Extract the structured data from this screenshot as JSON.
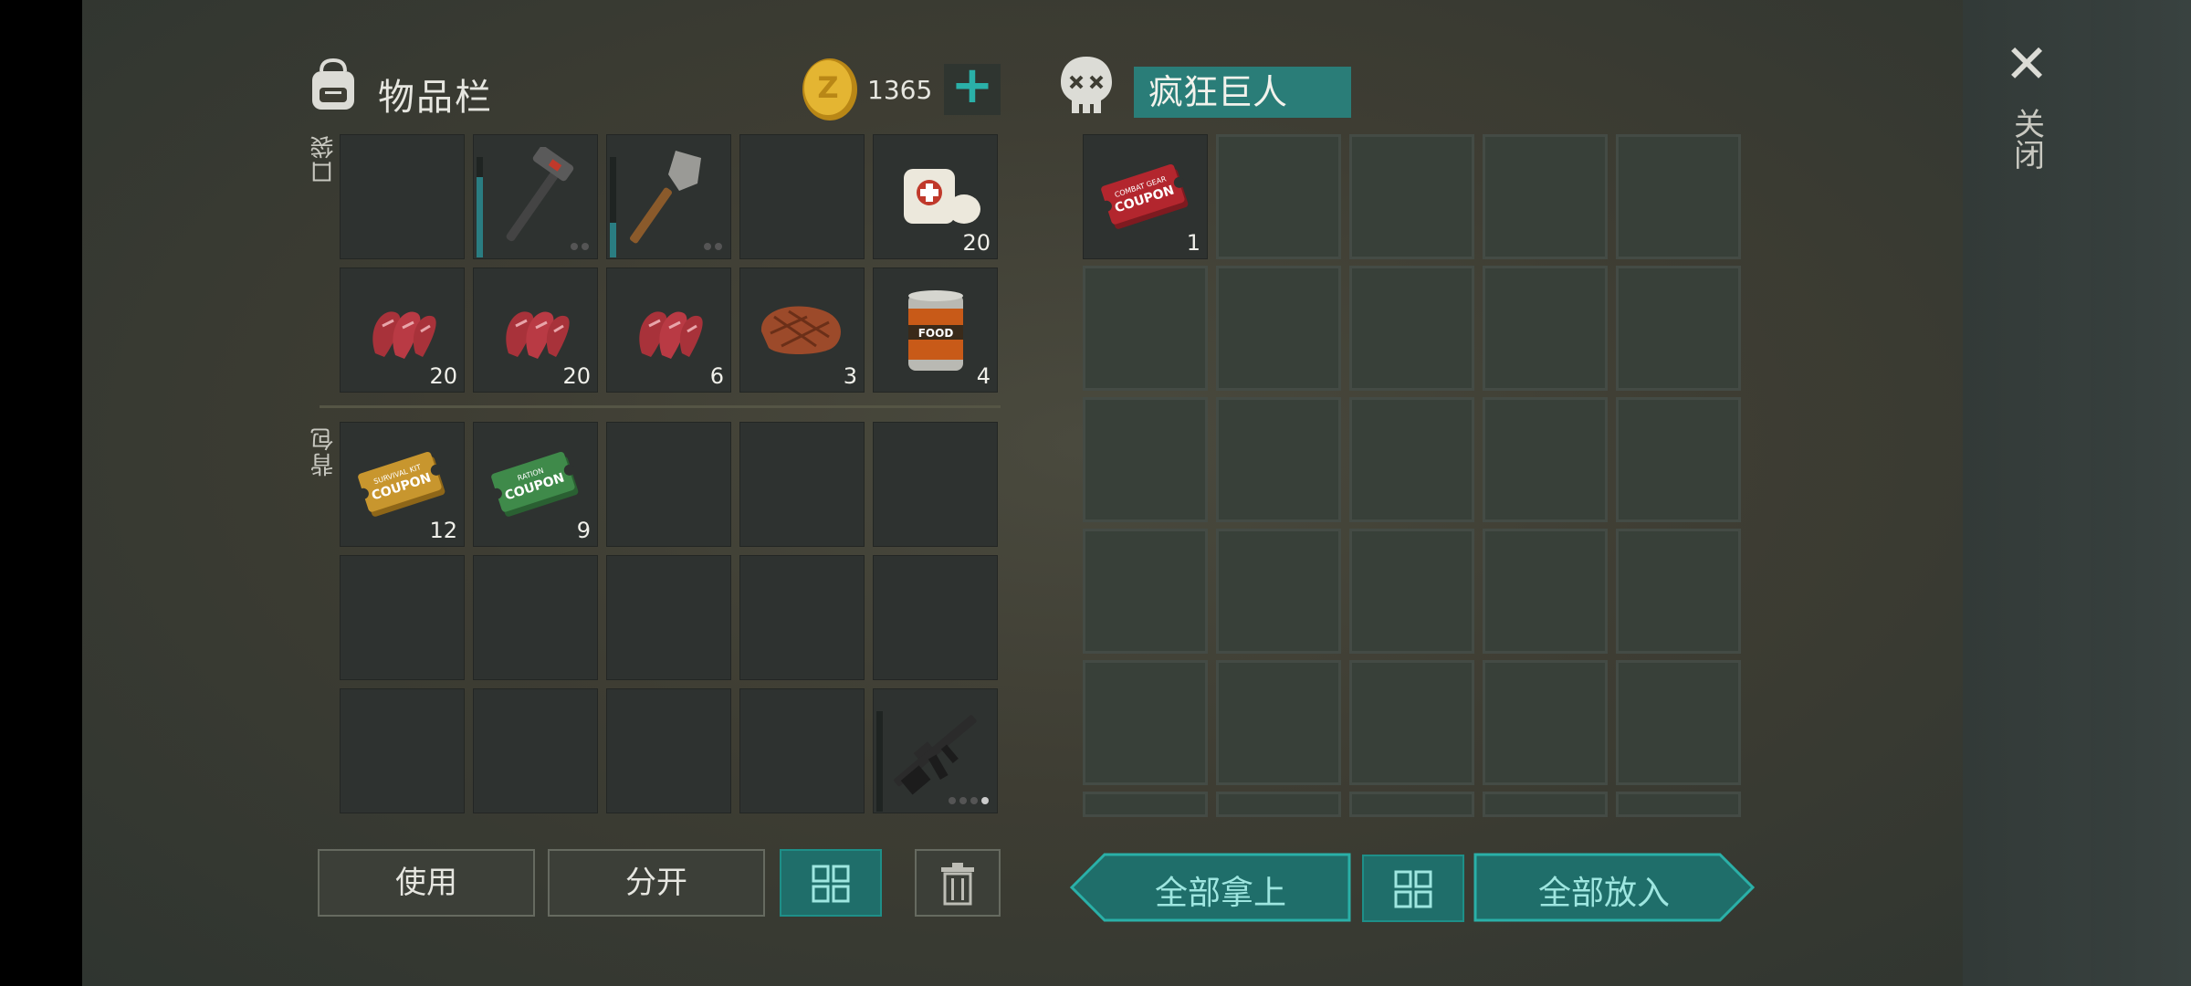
{
  "inventory": {
    "title": "物品栏",
    "pocket_label": "口袋",
    "backpack_label": "背包",
    "coins": "1365",
    "add_symbol": "+",
    "pocket_slots": [
      {
        "item": "",
        "count": ""
      },
      {
        "item": "hammer",
        "count": "",
        "durability": 0.8
      },
      {
        "item": "shovel",
        "count": "",
        "durability": 0.35
      },
      {
        "item": "",
        "count": ""
      },
      {
        "item": "bandage",
        "count": "20"
      },
      {
        "item": "raw-meat",
        "count": "20"
      },
      {
        "item": "raw-meat",
        "count": "20"
      },
      {
        "item": "raw-meat",
        "count": "6"
      },
      {
        "item": "steak",
        "count": "3"
      },
      {
        "item": "canned-food",
        "count": "4"
      }
    ],
    "backpack_slots": [
      {
        "item": "survival-kit-coupon",
        "count": "12",
        "ticket_top": "SURVIVAL KIT",
        "ticket_main": "COUPON"
      },
      {
        "item": "ration-coupon",
        "count": "9",
        "ticket_top": "RATION",
        "ticket_main": "COUPON"
      },
      {
        "item": "",
        "count": ""
      },
      {
        "item": "",
        "count": ""
      },
      {
        "item": "",
        "count": ""
      },
      {
        "item": "",
        "count": ""
      },
      {
        "item": "",
        "count": ""
      },
      {
        "item": "",
        "count": ""
      },
      {
        "item": "",
        "count": ""
      },
      {
        "item": "",
        "count": ""
      },
      {
        "item": "",
        "count": ""
      },
      {
        "item": "",
        "count": ""
      },
      {
        "item": "",
        "count": ""
      },
      {
        "item": "",
        "count": ""
      },
      {
        "item": "assault-rifle",
        "count": "",
        "ammo_dots": 4
      }
    ],
    "buttons": {
      "use": "使用",
      "split": "分开"
    }
  },
  "loot": {
    "owner_name": "疯狂巨人",
    "slots": [
      {
        "item": "combat-gear-coupon",
        "count": "1",
        "ticket_top": "COMBAT GEAR",
        "ticket_main": "COUPON"
      }
    ],
    "buttons": {
      "take_all": "全部拿上",
      "put_all": "全部放入"
    }
  },
  "close": {
    "symbol": "✕",
    "label": "关闭"
  },
  "colors": {
    "teal": "#1f6e6a",
    "teal_bright": "#2ab0a8",
    "coin_gold": "#d7a629",
    "meat_red": "#a8323a"
  }
}
